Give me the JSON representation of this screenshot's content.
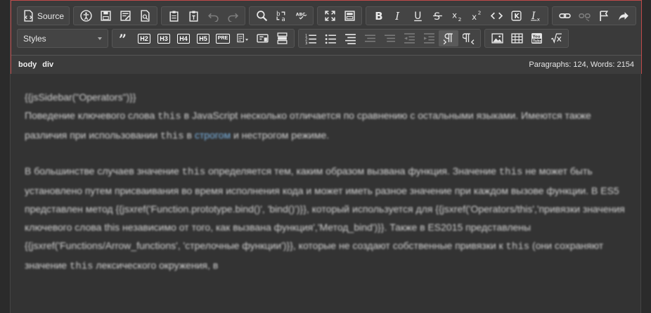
{
  "toolbar": {
    "source_label": "Source",
    "styles_label": "Styles",
    "heading_labels": [
      "H2",
      "H3",
      "H4",
      "H5",
      "PRE"
    ],
    "special_labels": {
      "spell": "ABC",
      "link_small": "K"
    }
  },
  "pathbar": {
    "crumbs": [
      "body",
      "div"
    ],
    "word_count": "Paragraphs: 124, Words: 2154"
  },
  "content": {
    "p1": {
      "line1": "{{jsSidebar(\"Operators\")}}",
      "a": "Поведение ключевого слова ",
      "code1": "this",
      "b": " в JavaScript несколько отличается по сравнению с остальными языками. Имеются также различия при использовании ",
      "code2": "this",
      "c": " в ",
      "link": "строгом",
      "d": " и нестрогом режиме."
    },
    "p2": {
      "a": "В большинстве случаев значение ",
      "code1": "this",
      "b": " определяется тем, каким образом вызвана функция. Значение ",
      "code2": "this",
      "c": " не может быть установлено путем присваивания во время исполнения кода и может иметь разное значение при каждом вызове функции. В ES5 представлен метод {{jsxref('Function.prototype.bind()', 'bind()')}}, который используется для {{jsxref('Operators/this','привязки значения ключевого слова this независимо от того, как вызвана функция','Метод_bind')}}. Также в ES2015 представлены {{jsxref('Functions/Arrow_functions', 'стрелочные функции')}}, которые не создают собственные привязки к ",
      "code3": "this",
      "d": " (они сохраняют значение ",
      "code4": "this",
      "e": " лексического окружения, в"
    }
  }
}
